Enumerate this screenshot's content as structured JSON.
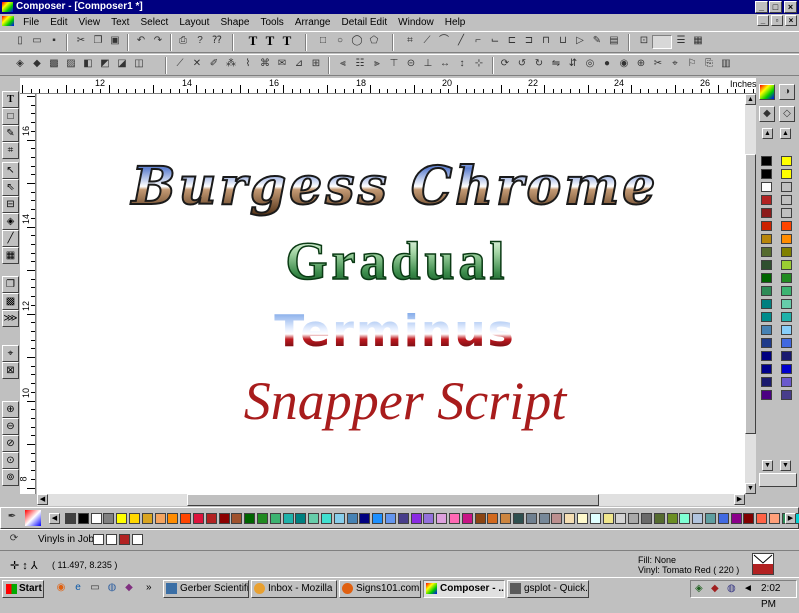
{
  "window": {
    "title": "Composer - [Composer1 *]"
  },
  "menu": [
    "File",
    "Edit",
    "View",
    "Text",
    "Select",
    "Layout",
    "Shape",
    "Tools",
    "Arrange",
    "Detail Edit",
    "Window",
    "Help"
  ],
  "ruler": {
    "units": "Inches",
    "top_labels": [
      "12",
      "14",
      "16",
      "18",
      "20",
      "22",
      "24",
      "26"
    ],
    "left_labels": [
      "16",
      "14",
      "12",
      "10",
      "8"
    ]
  },
  "canvas": {
    "text_objects": [
      {
        "text": "Burgess Chrome",
        "font": "burgess-chrome",
        "fill": "chrome"
      },
      {
        "text": "Gradual",
        "font": "gradual",
        "fill": "green-gradient"
      },
      {
        "text": "Terminus",
        "font": "terminus",
        "fill": "blue-red-chrome"
      },
      {
        "text": "Snapper Script",
        "font": "snapper-script",
        "fill": "#a81c1c"
      }
    ]
  },
  "vinyls": {
    "label": "Vinyls in Job:",
    "swatches": [
      "#ffffff",
      "#ffffff",
      "#b22222",
      "#ffffff"
    ]
  },
  "status": {
    "coords": "( 11.497, 8.235 )",
    "fill": "Fill: None",
    "vinyl": "Vinyl: Tomato Red ( 220 )"
  },
  "taskbar": {
    "start": "Start",
    "tasks": [
      "Gerber Scientifi...",
      "Inbox - Mozilla ...",
      "Signs101.com -...",
      "Composer - ...",
      "gsplot - Quick..."
    ],
    "time": "2:02 PM"
  },
  "colors": {
    "titlebar": "#000080",
    "right_palette": [
      "#000000",
      "#ffff00",
      "#000000",
      "#ffff00",
      "#ffffff",
      "#c0c0c0",
      "#b22222",
      "#c0c0c0",
      "#8b1a1a",
      "#c0c0c0",
      "#cc2200",
      "#ff4500",
      "#b8860b",
      "#ff8c00",
      "#556b2f",
      "#808000",
      "#2f4f2f",
      "#9acd32",
      "#006400",
      "#228b22",
      "#2e8b57",
      "#3cb371",
      "#008080",
      "#66cdaa",
      "#008b8b",
      "#20b2aa",
      "#4682b4",
      "#87cefa",
      "#1e3a8a",
      "#4169e1",
      "#000080",
      "#191970",
      "#00008b",
      "#0000cd",
      "#1a1a6e",
      "#6a5acd",
      "#4b0082",
      "#483d8b"
    ],
    "bottom_palette": [
      "#404040",
      "#000000",
      "#ffffff",
      "#808080",
      "#ffff00",
      "#ffd700",
      "#daa520",
      "#f4a460",
      "#ff8c00",
      "#ff4500",
      "#dc143c",
      "#b22222",
      "#8b0000",
      "#a0522d",
      "#006400",
      "#228b22",
      "#3cb371",
      "#20b2aa",
      "#008080",
      "#66cdaa",
      "#40e0d0",
      "#87ceeb",
      "#4682b4",
      "#000080",
      "#1e90ff",
      "#6495ed",
      "#483d8b",
      "#8a2be2",
      "#9370db",
      "#dda0dd",
      "#ff69b4",
      "#c71585",
      "#8b4513",
      "#d2691e",
      "#cd853f",
      "#2f4f4f",
      "#708090",
      "#778899",
      "#bc8f8f",
      "#f5deb3",
      "#fffacd",
      "#e0ffff",
      "#f0e68c",
      "#d3d3d3",
      "#a9a9a9",
      "#696969",
      "#556b2f",
      "#6b8e23",
      "#7fffd4",
      "#b0c4de",
      "#5f9ea0",
      "#4169e1",
      "#8b008b",
      "#800000",
      "#ff6347",
      "#ffa07a",
      "#2e8b57",
      "#00ced1",
      "#191970"
    ]
  }
}
